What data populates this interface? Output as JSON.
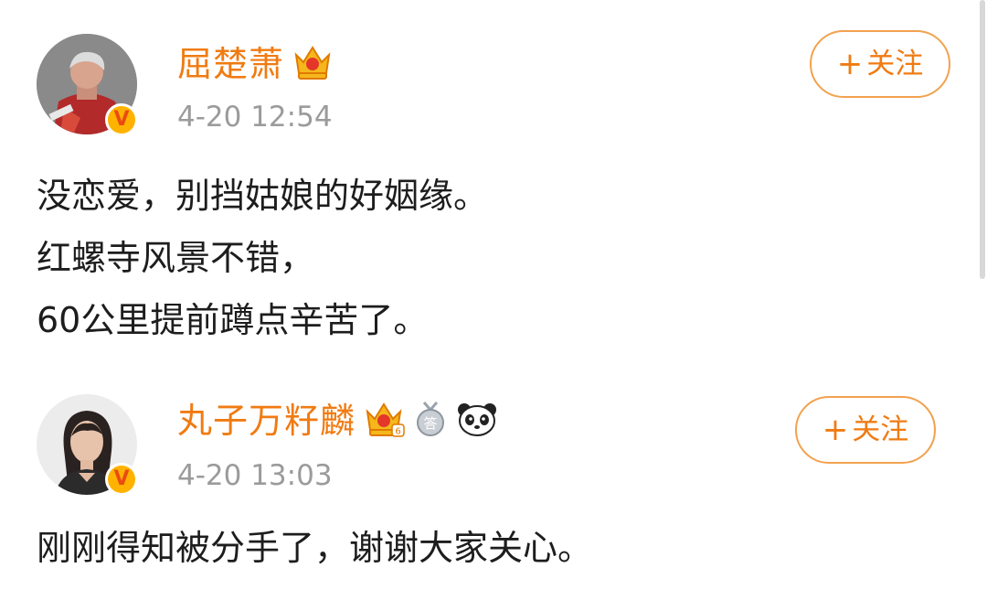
{
  "posts": [
    {
      "username": "屈楚萧",
      "timestamp": "4-20 12:54",
      "follow": {
        "plus": "+",
        "label": "关注"
      },
      "body_lines": [
        "没恋爱，别挡姑娘的好姻缘。",
        "红螺寺风景不错，",
        "60公里提前蹲点辛苦了。"
      ],
      "badges": [
        "crown-icon"
      ],
      "verified": "V"
    },
    {
      "username": "丸子万籽麟",
      "timestamp": "4-20 13:03",
      "follow": {
        "plus": "+",
        "label": "关注"
      },
      "body_lines": [
        "刚刚得知被分手了，谢谢大家关心。"
      ],
      "badges": [
        "crown-level-icon",
        "answer-medal-icon",
        "panda-icon"
      ],
      "crown_level": "6",
      "medal_text": "答",
      "verified": "V"
    }
  ],
  "colors": {
    "username": "#f07b12",
    "follow_border": "#f2a24f",
    "timestamp": "#9b9b9b",
    "body_text": "#1d1d1d",
    "verified_badge": "#ffb300"
  }
}
